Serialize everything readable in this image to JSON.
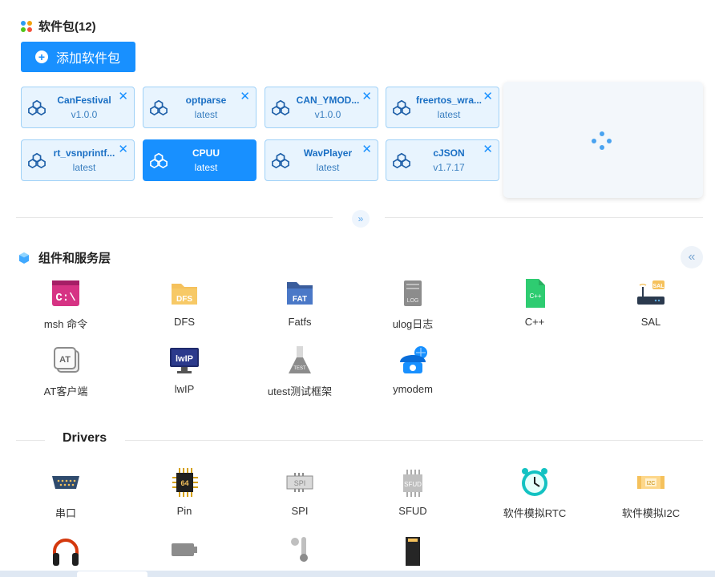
{
  "packages_section": {
    "title": "软件包(12)",
    "add_button": "添加软件包",
    "packages": [
      {
        "name": "CanFestival",
        "version": "v1.0.0",
        "active": false
      },
      {
        "name": "optparse",
        "version": "latest",
        "active": false
      },
      {
        "name": "CAN_YMOD...",
        "version": "v1.0.0",
        "active": false
      },
      {
        "name": "freertos_wra...",
        "version": "latest",
        "active": false
      },
      {
        "name": "rt_vsnprintf...",
        "version": "latest",
        "active": false
      },
      {
        "name": "CPUU",
        "version": "latest",
        "active": true
      },
      {
        "name": "WavPlayer",
        "version": "latest",
        "active": false
      },
      {
        "name": "cJSON",
        "version": "v1.7.17",
        "active": false
      }
    ]
  },
  "components_section": {
    "title": "组件和服务层",
    "items": [
      {
        "label": "msh 命令",
        "icon": "terminal-icon"
      },
      {
        "label": "DFS",
        "icon": "folder-icon"
      },
      {
        "label": "Fatfs",
        "icon": "fat-folder-icon"
      },
      {
        "label": "ulog日志",
        "icon": "log-icon"
      },
      {
        "label": "C++",
        "icon": "cpp-file-icon"
      },
      {
        "label": "SAL",
        "icon": "router-icon"
      },
      {
        "label": "AT客户端",
        "icon": "at-icon"
      },
      {
        "label": "lwIP",
        "icon": "monitor-icon"
      },
      {
        "label": "utest测试框架",
        "icon": "flask-icon"
      },
      {
        "label": "ymodem",
        "icon": "phone-icon"
      }
    ]
  },
  "drivers_section": {
    "title": "Drivers",
    "items": [
      {
        "label": "串口",
        "icon": "serial-port-icon"
      },
      {
        "label": "Pin",
        "icon": "chip-icon"
      },
      {
        "label": "SPI",
        "icon": "spi-icon"
      },
      {
        "label": "SFUD",
        "icon": "flash-chip-icon"
      },
      {
        "label": "软件模拟RTC",
        "icon": "clock-icon"
      },
      {
        "label": "软件模拟I2C",
        "icon": "i2c-icon"
      },
      {
        "label": "",
        "icon": "headphones-icon"
      },
      {
        "label": "",
        "icon": "battery-icon"
      },
      {
        "label": "",
        "icon": "thermometer-icon"
      },
      {
        "label": "",
        "icon": "sd-card-icon"
      }
    ]
  },
  "colors": {
    "primary": "#1890ff",
    "card_bg": "#e8f4fe"
  }
}
